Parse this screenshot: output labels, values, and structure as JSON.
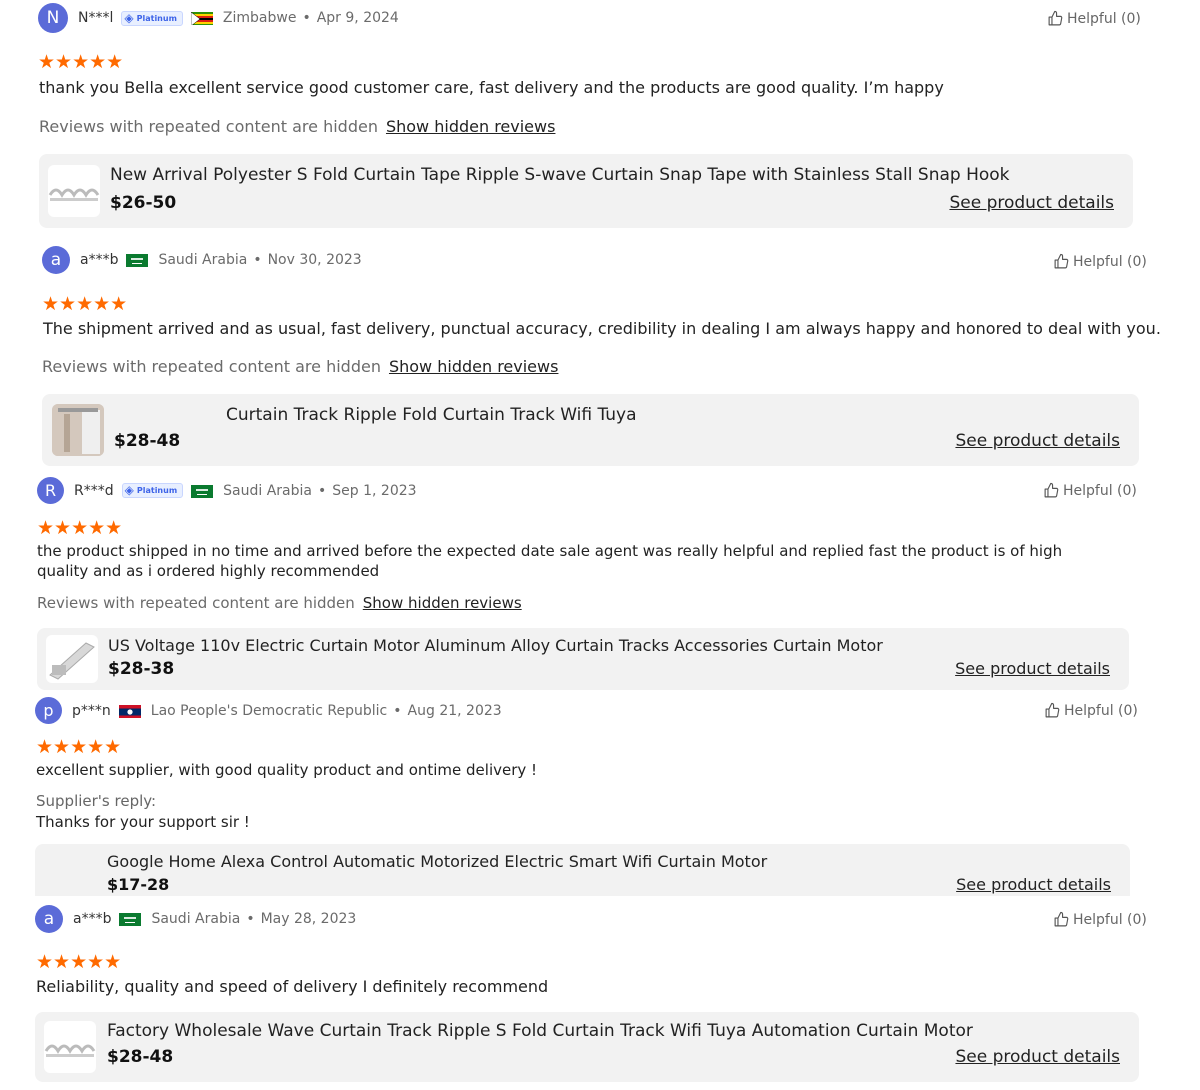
{
  "helpful_label": "Helpful (0)",
  "hidden_text": "Reviews with repeated content are hidden",
  "show_hidden_label": "Show hidden reviews",
  "see_details_label": "See product details",
  "stars": "★★★★★",
  "badge_label": "Platinum",
  "reviews": [
    {
      "initial": "N",
      "user": "N***l",
      "country": "Zimbabwe",
      "date": "Apr 9, 2024",
      "comment": "thank you Bella excellent service good customer care, fast delivery and the products are good quality. I’m happy",
      "product_title": "New Arrival Polyester S Fold Curtain Tape Ripple S-wave Curtain Snap Tape with Stainless Stall Snap Hook",
      "price": "$26-50"
    },
    {
      "initial": "a",
      "user": "a***b",
      "country": "Saudi Arabia",
      "date": "Nov 30, 2023",
      "comment": "The shipment arrived and as usual, fast delivery, punctual accuracy, credibility in dealing I am always happy and honored to deal with you.",
      "product_title": "Curtain Track Ripple Fold Curtain Track Wifi Tuya",
      "price": "$28-48"
    },
    {
      "initial": "R",
      "user": "R***d",
      "country": "Saudi Arabia",
      "date": "Sep 1, 2023",
      "comment": "the product shipped in no time and arrived before the expected date sale agent was really helpful and replied fast the product is of high quality and as i ordered highly recommended",
      "product_title": "US Voltage 110v Electric Curtain Motor Aluminum Alloy Curtain Tracks Accessories Curtain Motor",
      "price": "$28-38"
    },
    {
      "initial": "p",
      "user": "p***n",
      "country": "Lao People's Democratic Republic",
      "date": "Aug 21, 2023",
      "comment": "excellent supplier, with good quality product and ontime delivery !",
      "reply_label": "Supplier's reply:",
      "reply_text": "Thanks for your support sir !",
      "product_title": "Google Home Alexa Control Automatic Motorized Electric Smart Wifi Curtain Motor",
      "price": "$17-28"
    },
    {
      "initial": "a",
      "user": "a***b",
      "country": "Saudi Arabia",
      "date": "May 28, 2023",
      "comment": "Reliability, quality and speed of delivery I definitely recommend",
      "product_title": "Factory Wholesale Wave Curtain Track Ripple S Fold Curtain Track Wifi Tuya Automation Curtain Motor",
      "price": "$28-48"
    }
  ]
}
